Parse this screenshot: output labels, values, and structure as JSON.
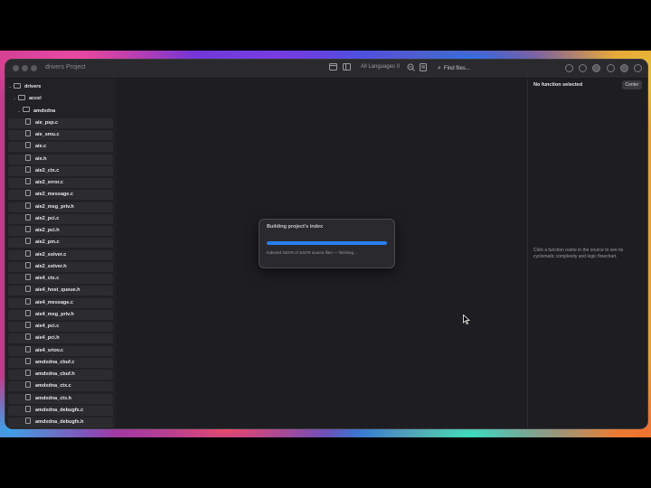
{
  "window": {
    "title": "drivers Project"
  },
  "toolbar": {
    "language_label": "All Languages",
    "language_count": "0",
    "search_placeholder": "Find files..."
  },
  "sidebar": {
    "items": [
      {
        "label": "drivers",
        "kind": "folder",
        "depth": 0
      },
      {
        "label": "accel",
        "kind": "folder",
        "depth": 1
      },
      {
        "label": "amdxdna",
        "kind": "folder",
        "depth": 2
      },
      {
        "label": "aie_psp.c",
        "kind": "file",
        "depth": 3
      },
      {
        "label": "aie_smu.c",
        "kind": "file",
        "depth": 3
      },
      {
        "label": "aie.c",
        "kind": "file",
        "depth": 3
      },
      {
        "label": "aie.h",
        "kind": "file",
        "depth": 3
      },
      {
        "label": "aie2_ctx.c",
        "kind": "file",
        "depth": 3
      },
      {
        "label": "aie2_error.c",
        "kind": "file",
        "depth": 3
      },
      {
        "label": "aie2_message.c",
        "kind": "file",
        "depth": 3
      },
      {
        "label": "aie2_msg_priv.h",
        "kind": "file",
        "depth": 3
      },
      {
        "label": "aie2_pci.c",
        "kind": "file",
        "depth": 3
      },
      {
        "label": "aie2_pci.h",
        "kind": "file",
        "depth": 3
      },
      {
        "label": "aie2_pm.c",
        "kind": "file",
        "depth": 3
      },
      {
        "label": "aie2_solver.c",
        "kind": "file",
        "depth": 3
      },
      {
        "label": "aie2_solver.h",
        "kind": "file",
        "depth": 3
      },
      {
        "label": "aie4_ctx.c",
        "kind": "file",
        "depth": 3
      },
      {
        "label": "aie4_host_queue.h",
        "kind": "file",
        "depth": 3
      },
      {
        "label": "aie4_message.c",
        "kind": "file",
        "depth": 3
      },
      {
        "label": "aie4_msg_priv.h",
        "kind": "file",
        "depth": 3
      },
      {
        "label": "aie4_pci.c",
        "kind": "file",
        "depth": 3
      },
      {
        "label": "aie4_pci.h",
        "kind": "file",
        "depth": 3
      },
      {
        "label": "aie4_sriov.c",
        "kind": "file",
        "depth": 3
      },
      {
        "label": "amdxdna_cbuf.c",
        "kind": "file",
        "depth": 3
      },
      {
        "label": "amdxdna_cbuf.h",
        "kind": "file",
        "depth": 3
      },
      {
        "label": "amdxdna_ctx.c",
        "kind": "file",
        "depth": 3
      },
      {
        "label": "amdxdna_ctx.h",
        "kind": "file",
        "depth": 3
      },
      {
        "label": "amdxdna_debugfx.c",
        "kind": "file",
        "depth": 3
      },
      {
        "label": "amdxdna_debugfx.h",
        "kind": "file",
        "depth": 3
      }
    ]
  },
  "right_panel": {
    "title": "No function selected",
    "center_button": "Center",
    "hint": "Click a function name in the source to see its cyclomatic complexity and logic flowchart."
  },
  "modal": {
    "title": "Building project's index",
    "progress_fraction": 1.0,
    "status": "Indexed 34376 of 34376 source files — finishing..."
  },
  "colors": {
    "accent": "#2a7ef0",
    "window_bg": "#1e1e22",
    "sidebar_bg": "#222226"
  }
}
